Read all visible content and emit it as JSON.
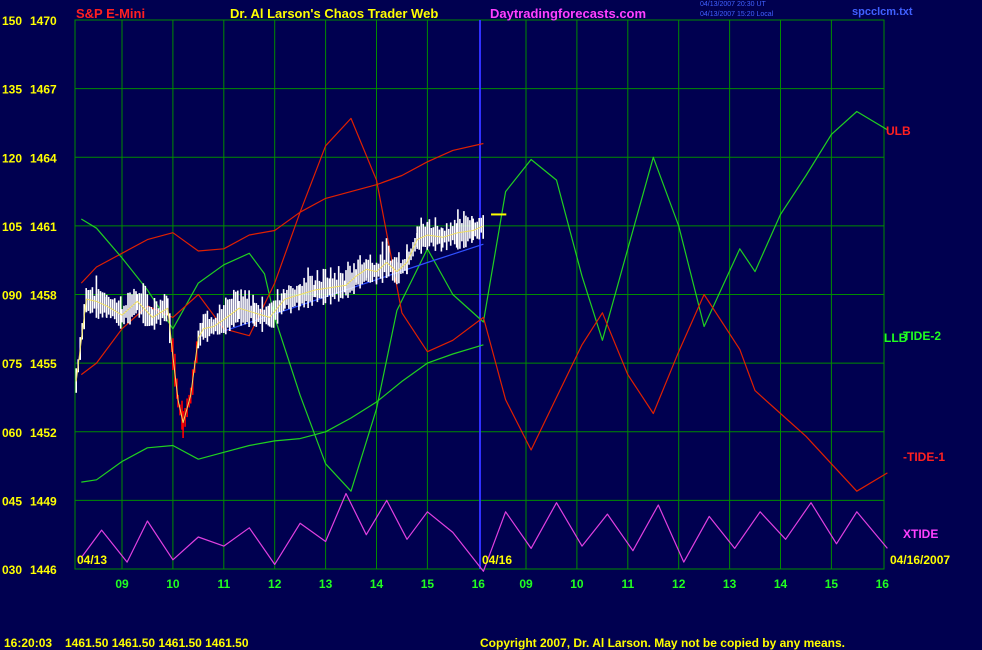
{
  "header": {
    "left_title": "S&P E-Mini",
    "center_title": "Dr. Al Larson's Chaos Trader Web",
    "website": "Daytradingforecasts.com",
    "timestamp_1": "04/13/2007 20:30 UT",
    "timestamp_2": "04/13/2007 15:20 Local",
    "filename": "spcclcm.txt"
  },
  "footer": {
    "clock": "16:20:03",
    "quotes": "1461.50 1461.50 1461.50 1461.50",
    "copyright": "Copyright 2007, Dr. Al Larson. May not be copied by any means."
  },
  "colors": {
    "background": "#000050",
    "grid": "#008C00",
    "axis_text": "#FFFF00",
    "price_bars": "#FFFFFF",
    "price_down": "#FF0000",
    "envelope": "#E02000",
    "tide": "#20D020",
    "xtide": "#E040E0",
    "divider": "#3030FF",
    "trend": "#3050FF"
  },
  "chart_data": {
    "type": "line",
    "title": "S&P E-Mini",
    "y_left_labels": [
      "150",
      "135",
      "120",
      "105",
      "090",
      "075",
      "060",
      "045",
      "030"
    ],
    "y_right_labels": [
      "1470",
      "1467",
      "1464",
      "1461",
      "1458",
      "1455",
      "1452",
      "1449",
      "1446"
    ],
    "ylim": [
      1446,
      1470
    ],
    "x_tick_labels_day1": [
      "09",
      "10",
      "11",
      "12",
      "13",
      "14",
      "15",
      "16"
    ],
    "x_tick_labels_day2": [
      "09",
      "10",
      "11",
      "12",
      "13",
      "14",
      "15",
      "16"
    ],
    "date_label_left": "04/13",
    "date_label_mid": "04/16",
    "date_label_right": "04/16/2007",
    "legend": [
      "ULB",
      "LLB",
      "TIDE-2",
      "-TIDE-1",
      "XTIDE"
    ],
    "last_price": 1461.5,
    "series": [
      {
        "name": "ULB",
        "x": [
          8.2,
          8.5,
          9,
          9.5,
          10,
          10.5,
          11,
          11.5,
          12,
          12.5,
          13,
          13.5,
          14,
          14.5,
          15,
          15.5,
          16.1
        ],
        "values": [
          1458.5,
          1459.2,
          1459.8,
          1460.4,
          1460.7,
          1459.9,
          1460.0,
          1460.6,
          1460.8,
          1461.6,
          1462.2,
          1462.5,
          1462.8,
          1463.2,
          1463.8,
          1464.3,
          1464.6
        ]
      },
      {
        "name": "LLB",
        "x": [
          8.2,
          8.5,
          9,
          9.5,
          10,
          10.5,
          11,
          11.5,
          12,
          12.5,
          13,
          13.5,
          14,
          14.5,
          15,
          15.5,
          16.1
        ],
        "values": [
          1449.8,
          1449.9,
          1450.7,
          1451.3,
          1451.4,
          1450.8,
          1451.1,
          1451.4,
          1451.6,
          1451.7,
          1452.0,
          1452.6,
          1453.3,
          1454.2,
          1455.0,
          1455.4,
          1455.8
        ]
      }
    ],
    "tide_2_day1": {
      "x": [
        8.2,
        8.5,
        9,
        9.5,
        10,
        10.5,
        11,
        11.5,
        11.8,
        12,
        12.5,
        13,
        13.5,
        14,
        14.4,
        15,
        15.5,
        16.1
      ],
      "values": [
        1461.3,
        1460.9,
        1459.6,
        1458.2,
        1456.5,
        1458.5,
        1459.3,
        1459.8,
        1458.9,
        1457.0,
        1453.6,
        1450.6,
        1449.4,
        1453.0,
        1457.3,
        1460.0,
        1458.0,
        1456.8
      ]
    },
    "tide_2_day2": {
      "x": [
        16.1,
        8.6,
        9.1,
        9.6,
        10.1,
        10.5,
        11.0,
        11.5,
        12,
        12.5,
        13.2,
        13.5,
        14,
        14.5,
        15,
        15.5,
        16.1
      ],
      "values": [
        1456.8,
        1462.5,
        1463.9,
        1463.0,
        1458.8,
        1456.0,
        1460.0,
        1464.0,
        1461.0,
        1456.6,
        1460.0,
        1459.0,
        1461.5,
        1463.2,
        1465.0,
        1466.0,
        1465.2
      ]
    },
    "tide_1_day1": {
      "x": [
        8.2,
        8.5,
        9,
        9.5,
        10,
        10.5,
        11,
        11.5,
        12,
        12.5,
        13,
        13.5,
        14,
        14.5,
        15,
        15.5,
        16.1
      ],
      "values": [
        1454.5,
        1455.0,
        1456.5,
        1457.5,
        1457.0,
        1458.0,
        1456.5,
        1456.2,
        1458.5,
        1461.6,
        1464.5,
        1465.7,
        1463.0,
        1457.2,
        1455.5,
        1456.0,
        1457.0
      ]
    },
    "tide_1_day2": {
      "x": [
        16.1,
        8.6,
        9.1,
        9.6,
        10.1,
        10.5,
        11,
        11.5,
        12,
        12.5,
        13.2,
        13.5,
        14,
        14.5,
        15,
        15.5,
        16.1
      ],
      "values": [
        1457.0,
        1453.4,
        1451.2,
        1453.5,
        1455.8,
        1457.2,
        1454.5,
        1452.8,
        1455.5,
        1458.0,
        1455.6,
        1453.8,
        1452.8,
        1451.8,
        1450.6,
        1449.4,
        1450.2
      ]
    },
    "xtide": {
      "x": [
        8.2,
        8.6,
        9.1,
        9.5,
        10,
        10.5,
        11,
        11.5,
        12,
        12.5,
        13,
        13.4,
        13.8,
        14.2,
        14.6,
        15.0,
        15.5,
        16.1,
        8.6,
        9.1,
        9.6,
        10.1,
        10.6,
        11.1,
        11.6,
        12.1,
        12.6,
        13.1,
        13.6,
        14.1,
        14.6,
        15.1,
        15.5,
        16.1
      ],
      "values": [
        1446.5,
        1447.7,
        1446.3,
        1448.1,
        1446.4,
        1447.4,
        1447.0,
        1447.8,
        1446.2,
        1448.0,
        1447.2,
        1449.3,
        1447.5,
        1449.0,
        1447.3,
        1448.5,
        1447.6,
        1445.9,
        1448.5,
        1446.9,
        1448.9,
        1447.0,
        1448.4,
        1446.8,
        1448.8,
        1446.3,
        1448.3,
        1446.9,
        1448.5,
        1447.3,
        1448.9,
        1447.1,
        1448.5,
        1446.9
      ]
    },
    "price": {
      "x": [
        8.1,
        8.3,
        8.5,
        8.7,
        9.0,
        9.3,
        9.6,
        9.9,
        10.0,
        10.1,
        10.2,
        10.35,
        10.5,
        10.6,
        10.8,
        11.0,
        11.3,
        11.6,
        11.9,
        12.2,
        12.5,
        12.8,
        13.1,
        13.4,
        13.6,
        13.8,
        14.0,
        14.2,
        14.4,
        14.6,
        14.8,
        15.0,
        15.3,
        15.6,
        15.9,
        16.1
      ],
      "values": [
        1454.2,
        1457.8,
        1457.7,
        1457.5,
        1457.1,
        1457.7,
        1457.0,
        1457.4,
        1455.3,
        1453.4,
        1452.4,
        1453.6,
        1456.1,
        1456.5,
        1456.6,
        1456.9,
        1457.4,
        1457.2,
        1457.0,
        1457.8,
        1458.0,
        1458.2,
        1458.3,
        1458.4,
        1458.8,
        1459.1,
        1459.0,
        1459.4,
        1459.0,
        1459.4,
        1460.4,
        1460.6,
        1460.5,
        1460.7,
        1460.8,
        1461.0
      ]
    },
    "trend": {
      "x": [
        11.0,
        13.0,
        15.0,
        16.1
      ],
      "values": [
        1456.4,
        1457.9,
        1459.4,
        1460.2
      ]
    }
  }
}
